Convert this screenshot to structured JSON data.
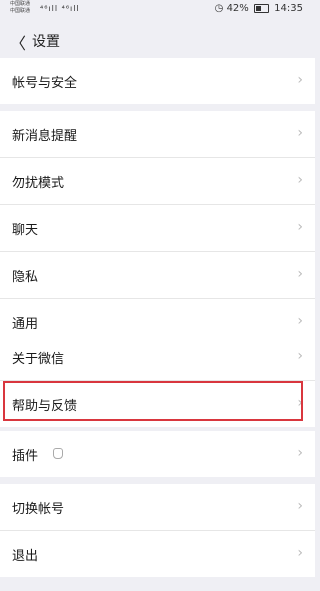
{
  "status_bar": {
    "carrier_1": "中国联通",
    "carrier_2": "中国联通",
    "signal_text": "⁴⁶ıll ⁴⁶ıll",
    "battery_percent": "42%",
    "time": "14:35"
  },
  "nav": {
    "back_glyph": "〈",
    "title": "设置"
  },
  "groups": [
    {
      "items": [
        "帐号与安全"
      ]
    },
    {
      "items": [
        "新消息提醒",
        "勿扰模式",
        "聊天",
        "隐私",
        "通用"
      ]
    },
    {
      "items": [
        "关于微信",
        "帮助与反馈"
      ]
    },
    {
      "items": [
        "插件"
      ]
    },
    {
      "items": [
        "切换帐号",
        "退出"
      ]
    }
  ],
  "chevron": "›",
  "highlighted_item": "帮助与反馈",
  "colors": {
    "background": "#efeff4",
    "highlight_border": "#d9363e"
  }
}
